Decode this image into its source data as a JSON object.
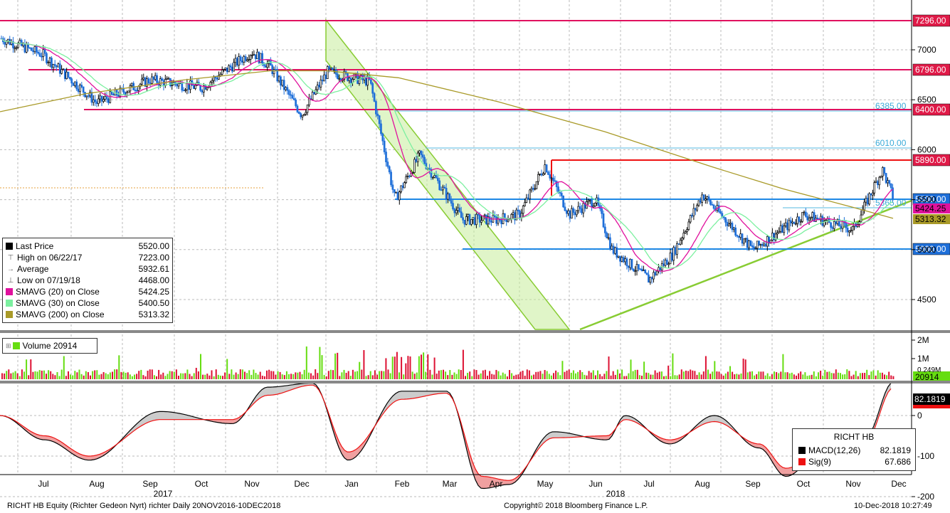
{
  "footer": {
    "left": "RICHT HB Equity (Richter Gedeon Nyrt) richter  Daily 20NOV2016-10DEC2018",
    "center": "Copyright© 2018 Bloomberg Finance L.P.",
    "right": "10-Dec-2018 10:27:49"
  },
  "legend": {
    "rows": [
      {
        "icon": "square-icon",
        "color": "#000000",
        "label": "Last Price",
        "value": "5520.00"
      },
      {
        "icon": "high-marker-icon",
        "color": "#666666",
        "label": "High on 06/22/17",
        "value": "7223.00"
      },
      {
        "icon": "average-marker-icon",
        "color": "#666666",
        "label": "Average",
        "value": "5932.61"
      },
      {
        "icon": "low-marker-icon",
        "color": "#666666",
        "label": "Low on 07/19/18",
        "value": "4468.00"
      },
      {
        "icon": "square-icon",
        "color": "#e0119d",
        "label": "SMAVG (20)  on Close",
        "value": "5424.25"
      },
      {
        "icon": "square-icon",
        "color": "#7cf0a0",
        "label": "SMAVG (30)  on Close",
        "value": "5400.50"
      },
      {
        "icon": "square-icon",
        "color": "#a99a28",
        "label": "SMAVG (200)  on Close",
        "value": "5313.32"
      }
    ]
  },
  "volume_legend": {
    "label": "Volume 20914",
    "color": "#66dd11"
  },
  "macd_legend": {
    "title": "RICHT HB",
    "rows": [
      {
        "color": "#000000",
        "label": "MACD(12,26)",
        "value": "82.1819"
      },
      {
        "color": "#ee1111",
        "label": "Sig(9)",
        "value": "67.686"
      }
    ]
  },
  "chart_data": [
    {
      "type": "candlestick",
      "ylim": [
        4300,
        7400
      ],
      "y_ticks": [
        4500,
        5000,
        5500,
        6000,
        6500,
        7000
      ],
      "x_labels": [
        "Jul",
        "Aug",
        "Sep",
        "Oct",
        "Nov",
        "Dec",
        "Jan",
        "Feb",
        "Mar",
        "Apr",
        "May",
        "Jun",
        "Jul",
        "Aug",
        "Sep",
        "Oct",
        "Nov",
        "Dec"
      ],
      "year_labels": [
        "2017",
        "2018"
      ],
      "price_anchors": [
        [
          "Jun",
          7120
        ],
        [
          "Jul",
          6950
        ],
        [
          "Aug",
          6470
        ],
        [
          "Sep",
          6700
        ],
        [
          "Oct",
          6620
        ],
        [
          "Nov",
          6980
        ],
        [
          "Nov-end",
          6830
        ],
        [
          "Dec",
          6350
        ],
        [
          "Jan",
          6780
        ],
        [
          "Jan-end",
          6680
        ],
        [
          "Feb",
          5500
        ],
        [
          "Feb-mid",
          5950
        ],
        [
          "Mar",
          5300
        ],
        [
          "Apr",
          5300
        ],
        [
          "Apr-end",
          5350
        ],
        [
          "May",
          5850
        ],
        [
          "May-mid",
          5350
        ],
        [
          "Jun",
          5500
        ],
        [
          "Jun-mid",
          5000
        ],
        [
          "Jul",
          4700
        ],
        [
          "Jul-end",
          4950
        ],
        [
          "Aug",
          5550
        ],
        [
          "Sep",
          5000
        ],
        [
          "Oct",
          5350
        ],
        [
          "Nov",
          5200
        ],
        [
          "Nov-end",
          5800
        ],
        [
          "Dec",
          5520
        ]
      ],
      "horizontal_levels": [
        {
          "value": "7296.00",
          "color": "#e0115f"
        },
        {
          "value": "6796.00",
          "color": "#e0115f"
        },
        {
          "value": "6400.00",
          "color": "#e0115f"
        },
        {
          "value": "5890.00",
          "color": "#ee1111"
        },
        {
          "value": "5500.00",
          "color": "#1e88e5"
        },
        {
          "value": "5000.00",
          "color": "#1e88e5"
        }
      ],
      "fib_labels": [
        "6385.00",
        "6010.00",
        "5365.00"
      ],
      "right_tags": [
        {
          "text": "5424.25",
          "color": "#e0119d"
        },
        {
          "text": "5313.32",
          "color": "#a99a28"
        }
      ]
    },
    {
      "type": "bar",
      "series_name": "Volume",
      "y_ticks": [
        "2M",
        "1M"
      ],
      "last_value": "20914",
      "partial_label": "0.249M"
    },
    {
      "type": "line",
      "y_ticks": [
        0,
        -100,
        -200
      ],
      "last_value": "82.1819",
      "series": [
        {
          "name": "MACD(12,26)",
          "anchors": [
            [
              0,
              0
            ],
            [
              0.05,
              -60
            ],
            [
              0.1,
              -110
            ],
            [
              0.18,
              10
            ],
            [
              0.26,
              -20
            ],
            [
              0.3,
              70
            ],
            [
              0.35,
              80
            ],
            [
              0.39,
              -110
            ],
            [
              0.45,
              60
            ],
            [
              0.5,
              60
            ],
            [
              0.54,
              -180
            ],
            [
              0.57,
              -170
            ],
            [
              0.62,
              -40
            ],
            [
              0.68,
              -60
            ],
            [
              0.7,
              0
            ],
            [
              0.75,
              -70
            ],
            [
              0.8,
              0
            ],
            [
              0.85,
              -80
            ],
            [
              0.88,
              -150
            ],
            [
              0.93,
              -60
            ],
            [
              0.97,
              -50
            ],
            [
              1.0,
              82
            ]
          ]
        },
        {
          "name": "Sig(9)",
          "anchors": [
            [
              0,
              0
            ],
            [
              0.05,
              -50
            ],
            [
              0.1,
              -100
            ],
            [
              0.18,
              -10
            ],
            [
              0.26,
              -10
            ],
            [
              0.3,
              50
            ],
            [
              0.35,
              75
            ],
            [
              0.39,
              -90
            ],
            [
              0.45,
              40
            ],
            [
              0.5,
              55
            ],
            [
              0.54,
              -150
            ],
            [
              0.57,
              -160
            ],
            [
              0.62,
              -55
            ],
            [
              0.68,
              -50
            ],
            [
              0.7,
              -10
            ],
            [
              0.75,
              -60
            ],
            [
              0.8,
              -15
            ],
            [
              0.85,
              -70
            ],
            [
              0.88,
              -130
            ],
            [
              0.93,
              -70
            ],
            [
              0.97,
              -60
            ],
            [
              1.0,
              68
            ]
          ]
        }
      ]
    }
  ]
}
